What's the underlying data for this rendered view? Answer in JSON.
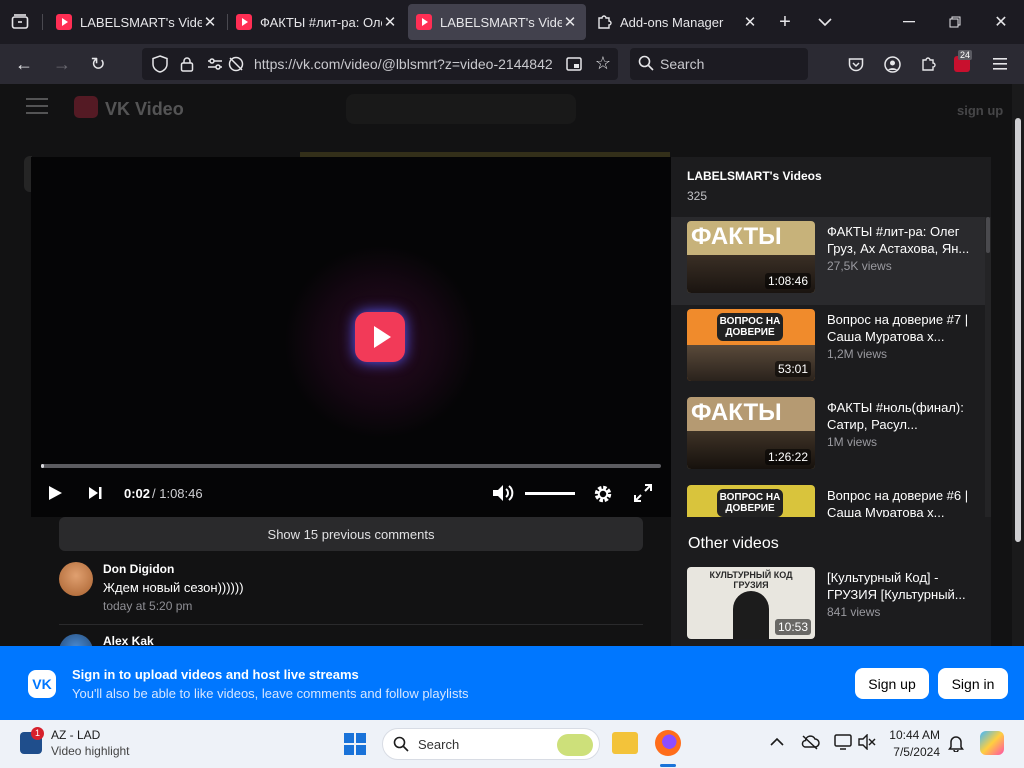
{
  "browser": {
    "tabs": [
      {
        "title": "LABELSMART's Videos",
        "active": false
      },
      {
        "title": "ФАКТЫ #лит-ра: Олег",
        "active": false
      },
      {
        "title": "LABELSMART's Videos",
        "active": true
      },
      {
        "title": "Add-ons Manager",
        "active": false
      }
    ],
    "url": "https://vk.com/video/@lblsmrt?z=video-2144842",
    "search_placeholder": "Search",
    "extension_badge": "24"
  },
  "site": {
    "logo_text": "VK Video",
    "signup_link": "sign up"
  },
  "player": {
    "current_time": "0:02",
    "total_time": " / 1:08:46",
    "progress_fraction": 0.0005,
    "volume_fraction": 1.0
  },
  "playlist": {
    "title": "LABELSMART's Videos",
    "count": "325",
    "items": [
      {
        "title": "ФАКТЫ #лит-ра: Олег Груз, Ах Астахова, Ян...",
        "views": "27,5K views",
        "duration": "1:08:46",
        "thumb_text": "ФАКТЫ",
        "thumb_color": "#c7b27a"
      },
      {
        "title": "Вопрос на доверие #7 | Саша Муратова х...",
        "views": "1,2M views",
        "duration": "53:01",
        "thumb_text": "ВОПРОС НА ДОВЕРИЕ",
        "thumb_color": "#f08b2c"
      },
      {
        "title": "ФАКТЫ #ноль(финал): Сатир, Расул...",
        "views": "1M views",
        "duration": "1:26:22",
        "thumb_text": "ФАКТЫ",
        "thumb_color": "#b59a72"
      },
      {
        "title": "Вопрос на доверие #6 | Саша Муратова х...",
        "views": "",
        "duration": "",
        "thumb_text": "ВОПРОС НА ДОВЕРИЕ",
        "thumb_color": "#d9c43c"
      }
    ]
  },
  "other_videos": {
    "heading": "Other videos",
    "items": [
      {
        "title": "[Культурный Код] - ГРУЗИЯ [Культурный...",
        "views": "841 views",
        "duration": "10:53",
        "thumb_text": "КУЛЬТУРНЫЙ КОД ГРУЗИЯ"
      }
    ]
  },
  "comments": {
    "show_previous": "Show 15 previous comments",
    "items": [
      {
        "author": "Don Digidon",
        "text": "Ждем новый сезон))))))",
        "time": "today at 5:20 pm"
      },
      {
        "author": "Alex Kak",
        "text": "",
        "time": ""
      }
    ]
  },
  "banner": {
    "title": "Sign in to upload videos and host live streams",
    "subtitle": "You'll also be able to like videos, leave comments and follow playlists",
    "signup": "Sign up",
    "signin": "Sign in"
  },
  "taskbar": {
    "news_title": "AZ - LAD",
    "news_subtitle": "Video highlight",
    "news_badge": "1",
    "search_placeholder": "Search",
    "time": "10:44 AM",
    "date": "7/5/2024"
  }
}
